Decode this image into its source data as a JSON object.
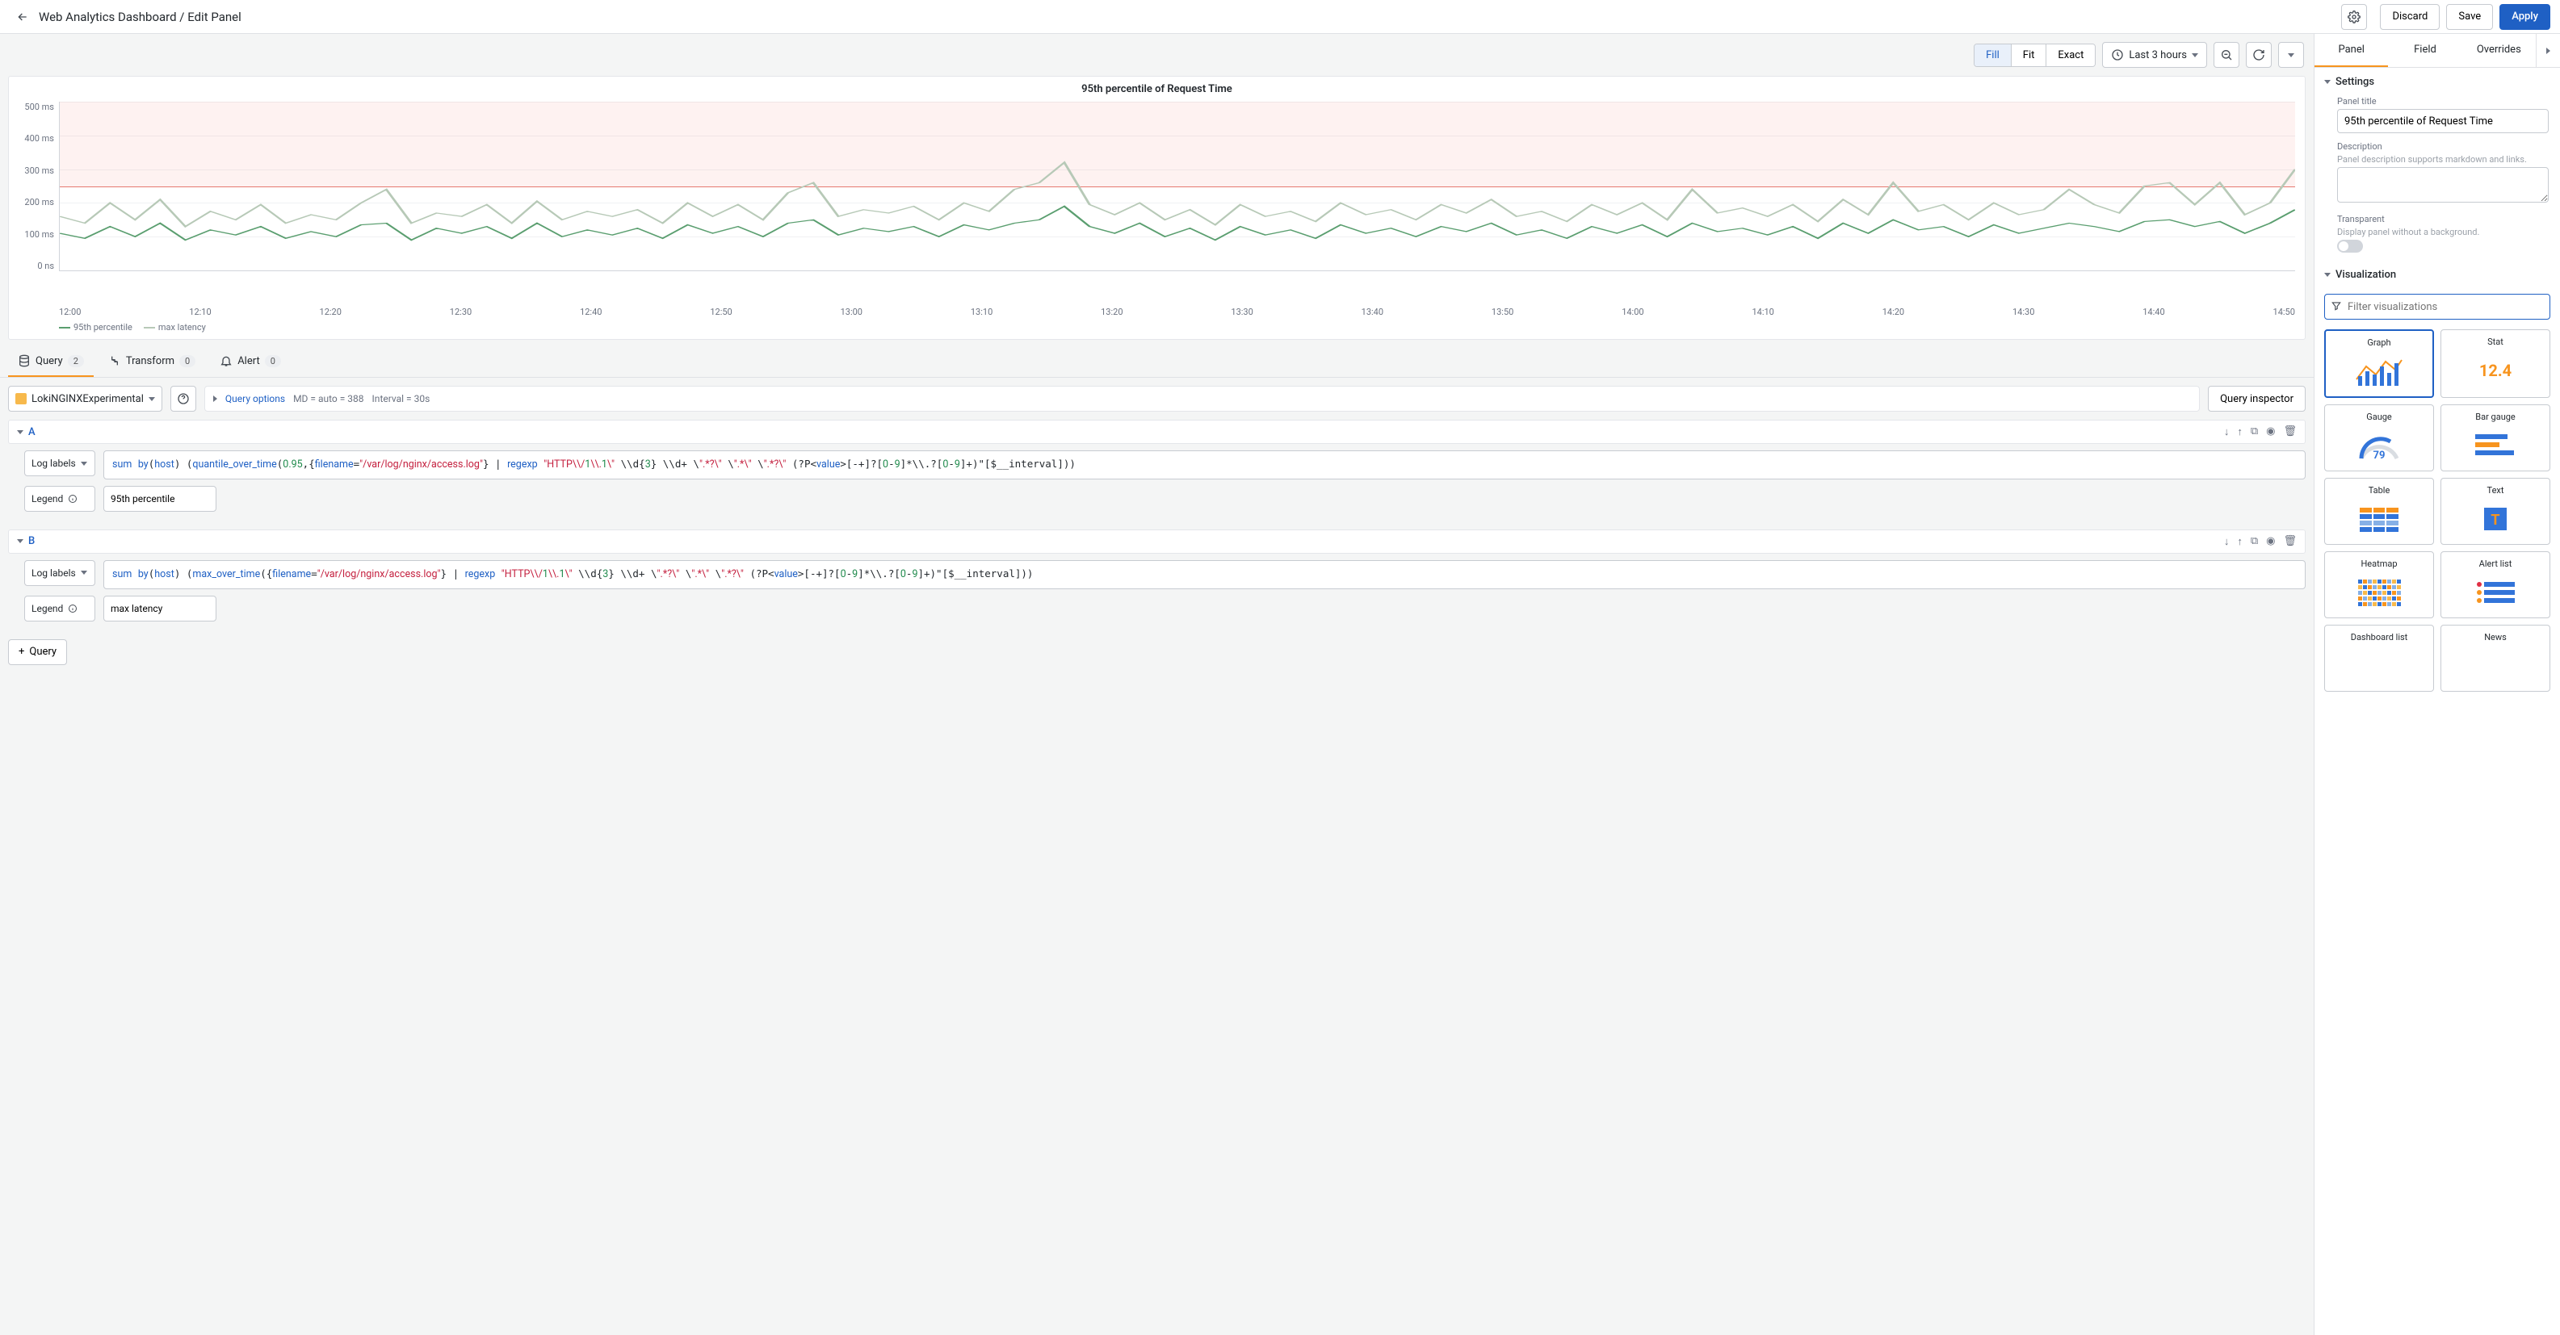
{
  "header": {
    "title": "Web Analytics Dashboard / Edit Panel",
    "discard": "Discard",
    "save": "Save",
    "apply": "Apply"
  },
  "viewToolbar": {
    "fill": "Fill",
    "fit": "Fit",
    "exact": "Exact",
    "timerange": "Last 3 hours"
  },
  "panel": {
    "title": "95th percentile of Request Time"
  },
  "chart_data": {
    "type": "line",
    "title": "95th percentile of Request Time",
    "ylabel": "",
    "ylim": [
      0,
      500
    ],
    "y_unit": "ms",
    "y_ticks": [
      "500 ms",
      "400 ms",
      "300 ms",
      "200 ms",
      "100 ms",
      "0 ns"
    ],
    "x_ticks": [
      "12:00",
      "12:10",
      "12:20",
      "12:30",
      "12:40",
      "12:50",
      "13:00",
      "13:10",
      "13:20",
      "13:30",
      "13:40",
      "13:50",
      "14:00",
      "14:10",
      "14:20",
      "14:30",
      "14:40",
      "14:50"
    ],
    "threshold": 250,
    "series": [
      {
        "name": "95th percentile",
        "color": "#5a9e6f",
        "values": [
          110,
          95,
          130,
          100,
          140,
          90,
          120,
          105,
          130,
          95,
          115,
          100,
          135,
          140,
          90,
          125,
          110,
          130,
          95,
          140,
          100,
          120,
          105,
          125,
          95,
          135,
          110,
          130,
          100,
          140,
          150,
          105,
          125,
          115,
          130,
          100,
          135,
          120,
          140,
          150,
          190,
          130,
          110,
          140,
          100,
          125,
          90,
          130,
          105,
          120,
          95,
          135,
          110,
          125,
          100,
          130,
          115,
          140,
          105,
          120,
          95,
          130,
          110,
          135,
          100,
          140,
          115,
          125,
          105,
          130,
          95,
          140,
          110,
          150,
          120,
          130,
          100,
          135,
          110,
          125,
          140,
          130,
          115,
          145,
          150,
          130,
          145,
          110,
          140,
          180
        ]
      },
      {
        "name": "max latency",
        "color": "#b7c9b7",
        "values": [
          160,
          140,
          200,
          150,
          210,
          130,
          175,
          150,
          195,
          140,
          165,
          150,
          200,
          240,
          140,
          170,
          160,
          195,
          140,
          205,
          150,
          175,
          160,
          180,
          140,
          200,
          160,
          195,
          150,
          230,
          260,
          160,
          180,
          170,
          190,
          150,
          200,
          175,
          240,
          260,
          320,
          195,
          165,
          200,
          150,
          180,
          135,
          195,
          160,
          175,
          145,
          200,
          165,
          180,
          150,
          195,
          170,
          210,
          160,
          175,
          145,
          195,
          165,
          200,
          150,
          240,
          170,
          185,
          160,
          195,
          145,
          210,
          165,
          260,
          175,
          195,
          150,
          200,
          165,
          180,
          240,
          195,
          170,
          250,
          260,
          195,
          260,
          165,
          200,
          300
        ]
      }
    ]
  },
  "tabs": {
    "query": {
      "label": "Query",
      "count": "2"
    },
    "transform": {
      "label": "Transform",
      "count": "0"
    },
    "alert": {
      "label": "Alert",
      "count": "0"
    }
  },
  "queryToolbar": {
    "datasource": "LokiNGINXExperimental",
    "optionsLabel": "Query options",
    "mdInfo": "MD = auto = 388",
    "intervalInfo": "Interval = 30s",
    "inspector": "Query inspector"
  },
  "queries": {
    "a": {
      "letter": "A",
      "labelField": "Log labels",
      "expr": "sum by(host) (quantile_over_time(0.95,{filename=\"/var/log/nginx/access.log\"} | regexp \"HTTP\\\\/1\\\\.1\\\" \\\\d{3} \\\\d+ \\\".*?\\\" \\\".*\\\" \\\".*?\\\" (?P<value>[-+]?[0-9]*\\\\.?[0-9]+)\"[$__interval]))",
      "legendField": "Legend",
      "legend": "95th percentile"
    },
    "b": {
      "letter": "B",
      "labelField": "Log labels",
      "expr": "sum by(host) (max_over_time({filename=\"/var/log/nginx/access.log\"} | regexp \"HTTP\\\\/1\\\\.1\\\" \\\\d{3} \\\\d+ \\\".*?\\\" \\\".*\\\" \\\".*?\\\" (?P<value>[-+]?[0-9]*\\\\.?[0-9]+)\"[$__interval]))",
      "legendField": "Legend",
      "legend": "max latency"
    }
  },
  "addQuery": "Query",
  "sideTabs": {
    "panel": "Panel",
    "field": "Field",
    "overrides": "Overrides"
  },
  "settings": {
    "header": "Settings",
    "titleLabel": "Panel title",
    "titleValue": "95th percentile of Request Time",
    "descLabel": "Description",
    "descHint": "Panel description supports markdown and links.",
    "transparentLabel": "Transparent",
    "transparentHint": "Display panel without a background."
  },
  "visualization": {
    "header": "Visualization",
    "filterPlaceholder": "Filter visualizations",
    "items": {
      "graph": "Graph",
      "stat": "Stat",
      "statValue": "12.4",
      "gauge": "Gauge",
      "gaugeValue": "79",
      "bargauge": "Bar gauge",
      "table": "Table",
      "text": "Text",
      "heatmap": "Heatmap",
      "alertlist": "Alert list",
      "dashlist": "Dashboard list",
      "news": "News"
    }
  }
}
